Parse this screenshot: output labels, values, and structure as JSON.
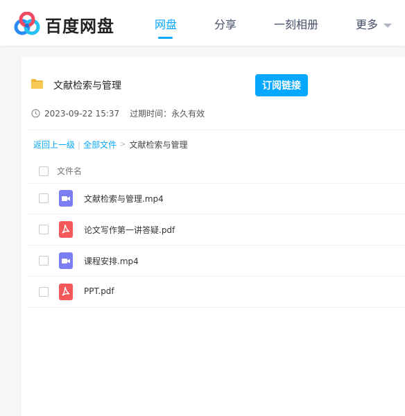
{
  "brand": {
    "name": "百度网盘",
    "logo_icon": "baidu-netdisk-logo-icon"
  },
  "nav": {
    "items": [
      {
        "label": "网盘",
        "active": true
      },
      {
        "label": "分享",
        "active": false
      },
      {
        "label": "一刻相册",
        "active": false
      },
      {
        "label": "更多",
        "active": false,
        "has_dropdown": true
      }
    ]
  },
  "share": {
    "title": "文献检索与管理",
    "subscribe_label": "订阅链接",
    "created": "2023-09-22 15:37",
    "expire_label": "过期时间：",
    "expire_value": "永久有效"
  },
  "breadcrumb": {
    "back": "返回上一级",
    "sep": "|",
    "all_files": "全部文件",
    "arrow": ">",
    "current": "文献检索与管理"
  },
  "table": {
    "header": "文件名",
    "files": [
      {
        "name": "文献检索与管理.mp4",
        "type": "video",
        "icon": "video-file-icon"
      },
      {
        "name": "论文写作第一讲答疑.pdf",
        "type": "pdf",
        "icon": "pdf-file-icon"
      },
      {
        "name": "课程安排.mp4",
        "type": "video",
        "icon": "video-file-icon"
      },
      {
        "name": "PPT.pdf",
        "type": "pdf",
        "icon": "pdf-file-icon"
      }
    ]
  },
  "colors": {
    "accent": "#06a7ff",
    "video": "#7b7ef2",
    "pdf": "#f4585b",
    "folder": "#f2b53a"
  }
}
